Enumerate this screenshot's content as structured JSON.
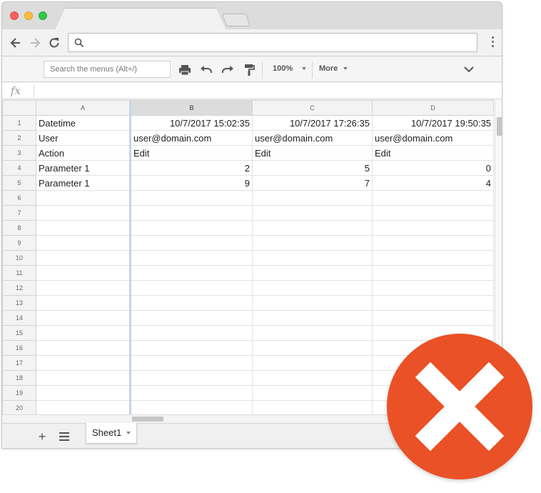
{
  "browser": {
    "address_value": "",
    "back_icon": "arrow-left-icon",
    "forward_icon": "arrow-right-icon",
    "reload_icon": "reload-icon"
  },
  "toolbar": {
    "menu_search_placeholder": "Search the menus (Alt+/)",
    "zoom": "100%",
    "more_label": "More"
  },
  "formula": {
    "fx_label": "fx",
    "value": ""
  },
  "sheet": {
    "columns": [
      "A",
      "B",
      "C",
      "D"
    ],
    "rows": [
      {
        "num": "1",
        "cells": [
          "Datetime",
          "10/7/2017 15:02:35",
          "10/7/2017 17:26:35",
          "10/7/2017 19:50:35"
        ]
      },
      {
        "num": "2",
        "cells": [
          "User",
          "user@domain.com",
          "user@domain.com",
          "user@domain.com"
        ]
      },
      {
        "num": "3",
        "cells": [
          "Action",
          "Edit",
          "Edit",
          "Edit"
        ]
      },
      {
        "num": "4",
        "cells": [
          "Parameter 1",
          "2",
          "5",
          "0"
        ]
      },
      {
        "num": "5",
        "cells": [
          "Parameter 1",
          "9",
          "7",
          "4"
        ]
      },
      {
        "num": "6",
        "cells": [
          "",
          "",
          "",
          ""
        ]
      },
      {
        "num": "7",
        "cells": [
          "",
          "",
          "",
          ""
        ]
      },
      {
        "num": "8",
        "cells": [
          "",
          "",
          "",
          ""
        ]
      },
      {
        "num": "9",
        "cells": [
          "",
          "",
          "",
          ""
        ]
      },
      {
        "num": "10",
        "cells": [
          "",
          "",
          "",
          ""
        ]
      },
      {
        "num": "11",
        "cells": [
          "",
          "",
          "",
          ""
        ]
      },
      {
        "num": "12",
        "cells": [
          "",
          "",
          "",
          ""
        ]
      },
      {
        "num": "13",
        "cells": [
          "",
          "",
          "",
          ""
        ]
      },
      {
        "num": "14",
        "cells": [
          "",
          "",
          "",
          ""
        ]
      },
      {
        "num": "15",
        "cells": [
          "",
          "",
          "",
          ""
        ]
      },
      {
        "num": "16",
        "cells": [
          "",
          "",
          "",
          ""
        ]
      },
      {
        "num": "17",
        "cells": [
          "",
          "",
          "",
          ""
        ]
      },
      {
        "num": "18",
        "cells": [
          "",
          "",
          "",
          ""
        ]
      },
      {
        "num": "19",
        "cells": [
          "",
          "",
          "",
          ""
        ]
      },
      {
        "num": "20",
        "cells": [
          "",
          "",
          "",
          ""
        ]
      }
    ]
  },
  "tabs": {
    "sheet_name": "Sheet1",
    "add_label": "+"
  },
  "badge": {
    "icon": "error-x-icon",
    "color": "#ea5126"
  }
}
